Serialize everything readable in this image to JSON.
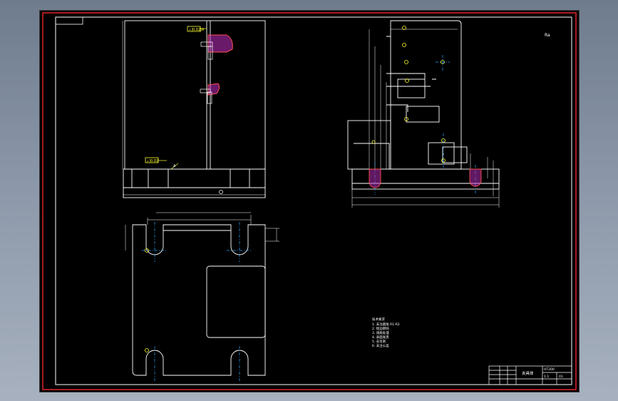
{
  "colors": {
    "border": "#e0242a",
    "frame": "#ffffff",
    "lines": "#ffffff",
    "center": "#2aa8ff",
    "hatch": "#c02fc0",
    "callout": "#ffff33",
    "background": "#000000"
  },
  "drawing": {
    "front_view": {
      "callout_tol_top": "⊥|0.02|A",
      "callout_tol_bottom": "⊥|0.02",
      "datum_mark": "A"
    },
    "side_view": {
      "mark": "Ra"
    },
    "notes": {
      "lines": [
        "技术要求",
        "1. 未注圆角 R1-R2",
        "2. 锐边倒钝",
        "3. 调质处理",
        "4. 表面发黑",
        "5. 去毛刺",
        "6. 未注公差"
      ]
    },
    "title_block": {
      "name": "夹具体",
      "material": "HT200",
      "scale": "1:1",
      "sheet": "01"
    }
  }
}
